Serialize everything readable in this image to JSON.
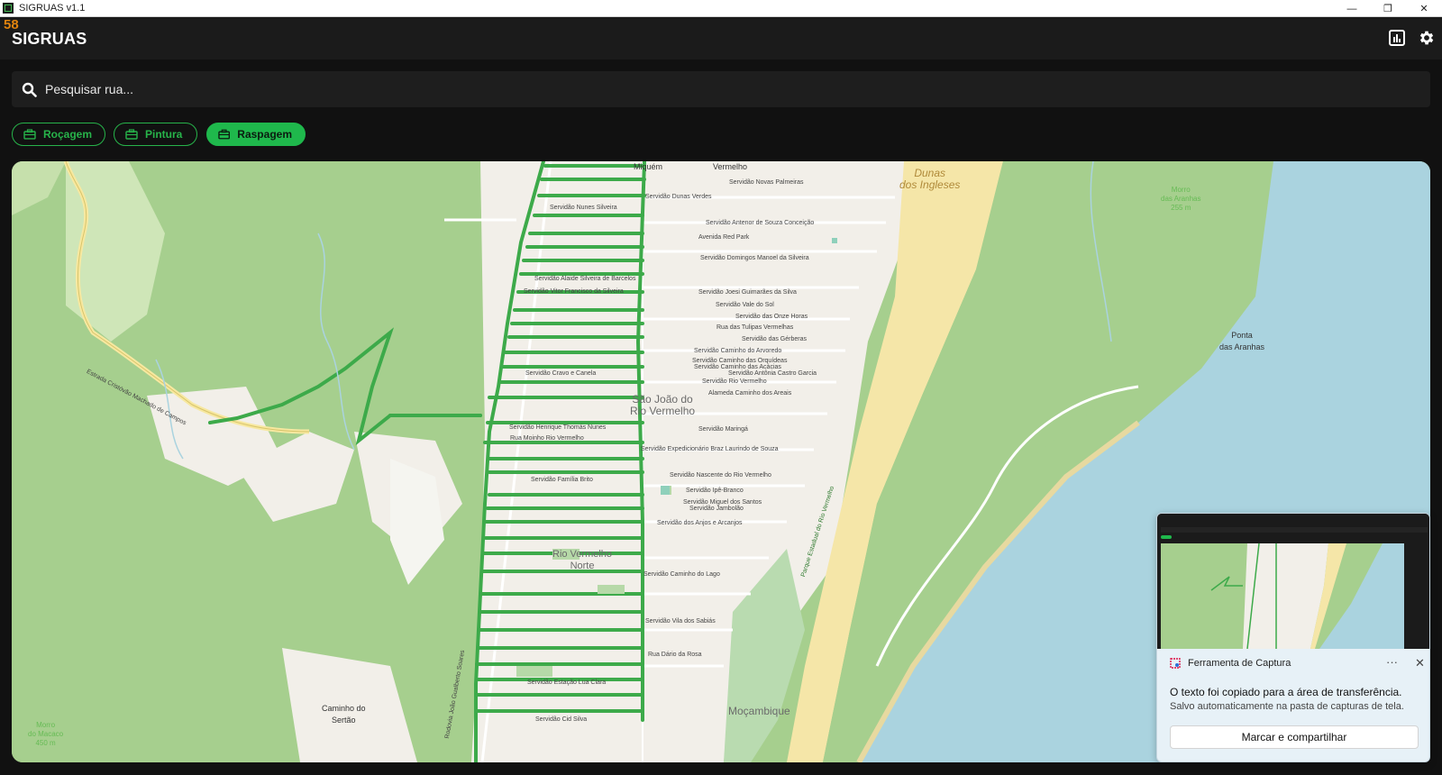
{
  "window": {
    "title": "SIGRUAS v1.1",
    "minimize": "—",
    "restore": "❐",
    "close": "✕"
  },
  "header": {
    "fps": "58",
    "title": "SIGRUAS",
    "chart_icon": "bar-chart-icon",
    "settings_icon": "gear-icon"
  },
  "search": {
    "placeholder": "Pesquisar rua...",
    "value": ""
  },
  "filters": [
    {
      "label": "Roçagem",
      "active": false
    },
    {
      "label": "Pintura",
      "active": false
    },
    {
      "label": "Raspagem",
      "active": true
    }
  ],
  "colors": {
    "accent": "#1fb84c",
    "route": "#3daa4a",
    "header_bg": "#1b1b1b",
    "water": "#aad3df",
    "forest": "#a6cf8e",
    "urban": "#f2efe9",
    "beach": "#f5e6a8"
  },
  "map": {
    "places": {
      "sao_joao": "São João do\nRio Vermelho",
      "rio_vermelho_norte": "Rio Vermelho\nNorte",
      "mocambique": "Moçambique",
      "caminho_sertao": "Caminho do\nSertão",
      "dunas": "Dunas\ndos Ingleses",
      "ponta_aranhas": "Ponta\ndas Aranhas",
      "morro_aranhas": "Morro\ndas Aranhas\n255 m",
      "morro_macaco": "Morro\ndo Macaco\n450 m",
      "miquem": "Miquém",
      "vermelho": "Vermelho"
    },
    "streets": [
      "Servidão Novas Palmeiras",
      "Servidão Dunas Verdes",
      "Servidão Nunes Silveira",
      "Servidão Antenor de Souza Conceição",
      "Avenida Red Park",
      "Servidão Domingos Manoel da Silveira",
      "Servidão Alaide Silveira de Barcelos",
      "Servidão Vitor Francisco da Silveira",
      "Servidão Joesi Guimarães da Silva",
      "Servidão Vale do Sol",
      "Servidão das Onze Horas",
      "Rua das Tulipas Vermelhas",
      "Servidão das Gérberas",
      "Servidão Caminho do Arvoredo",
      "Servidão Caminho das Orquídeas",
      "Servidão Caminho das Acácias",
      "Servidão Antônia Castro Garcia",
      "Servidão Cravo e Canela",
      "Servidão Rio Vermelho",
      "Alameda Caminho dos Areais",
      "Servidão Henrique Thomás Nunes",
      "Servidão Maringá",
      "Rua Moinho Rio Vermelho",
      "Servidão Expedicionário Braz Laurindo de Souza",
      "Servidão Nascente do Rio Vermelho",
      "Servidão Família Brito",
      "Servidão Ipê-Branco",
      "Servidão Miguel dos Santos",
      "Servidão Jambolão",
      "Servidão dos Anjos e Arcanjos",
      "Servidão Caminho do Lago",
      "Servidão Vila dos Sabiás",
      "Rua Dário da Rosa",
      "Servidão Estação Lua Clara",
      "Servidão Cid Silva",
      "Estrada Cristóvão Machado de Campos",
      "Parque Estadual do Rio Vermelho",
      "Rodovia João Gualberto Soares"
    ]
  },
  "toast": {
    "app_name": "Ferramenta de Captura",
    "more": "···",
    "close": "✕",
    "message": "O texto foi copiado para a área de transferência.",
    "sub": "Salvo automaticamente na pasta de capturas de tela.",
    "button": "Marcar e compartilhar"
  }
}
